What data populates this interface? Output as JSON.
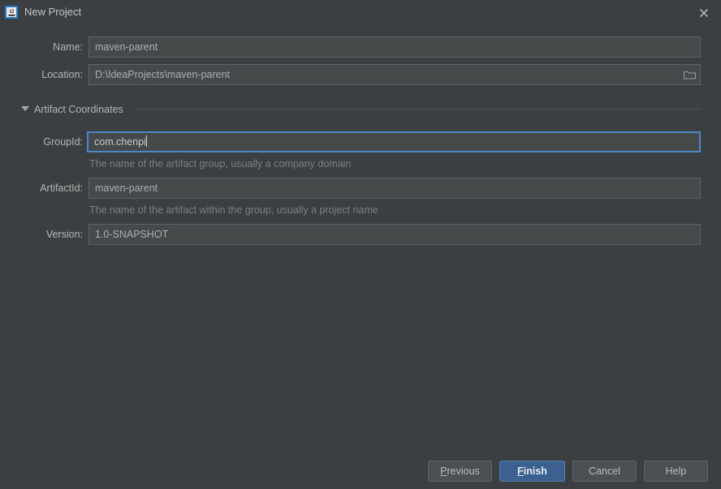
{
  "window": {
    "title": "New Project",
    "app_icon": "intellij-idea-icon",
    "close_icon": "close-icon"
  },
  "form": {
    "name": {
      "label": "Name:",
      "value": "maven-parent",
      "placeholder": ""
    },
    "location": {
      "label": "Location:",
      "value": "D:\\IdeaProjects\\maven-parent",
      "placeholder": "",
      "browse_icon": "folder-icon"
    }
  },
  "section": {
    "title": "Artifact Coordinates",
    "expand_icon": "triangle-down-icon",
    "expanded": true
  },
  "coordinates": {
    "group_id": {
      "label": "GroupId:",
      "value": "com.chenpi",
      "placeholder": "",
      "hint": "The name of the artifact group, usually a company domain",
      "focused": true
    },
    "artifact_id": {
      "label": "ArtifactId:",
      "value": "maven-parent",
      "placeholder": "",
      "hint": "The name of the artifact within the group, usually a project name",
      "focused": false
    },
    "version": {
      "label": "Version:",
      "value": "1.0-SNAPSHOT",
      "placeholder": "",
      "focused": false
    }
  },
  "buttons": {
    "previous": {
      "label": "Previous",
      "mnemonic": "P"
    },
    "finish": {
      "label": "Finish",
      "mnemonic": "F",
      "primary": true
    },
    "cancel": {
      "label": "Cancel",
      "mnemonic": ""
    },
    "help": {
      "label": "Help",
      "mnemonic": ""
    }
  },
  "colors": {
    "dialog_background": "#3c3f41",
    "field_background": "#45494a",
    "field_border": "#5e6366",
    "focus_border": "#4a88c7",
    "primary_button": "#3c6190",
    "text": "#bbbbbb",
    "hint_text": "#7a7f82"
  }
}
